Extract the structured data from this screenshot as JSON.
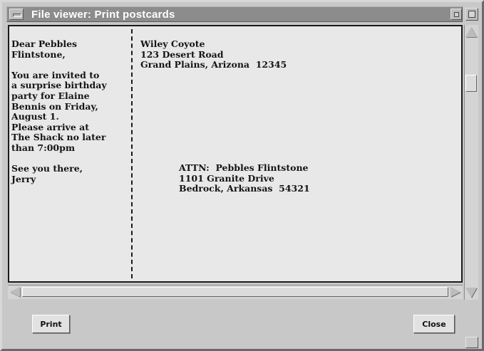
{
  "window": {
    "title": "File viewer: Print postcards"
  },
  "postcard": {
    "message": "Dear Pebbles\nFlintstone,\n\nYou are invited to\na surprise birthday\nparty for Elaine\nBennis on Friday,\nAugust 1.\nPlease arrive at\nThe Shack no later\nthan 7:00pm\n\nSee you there,\nJerry",
    "return_address": "Wiley Coyote\n123 Desert Road\nGrand Plains, Arizona  12345",
    "recipient_address": "ATTN:  Pebbles Flintstone\n1101 Granite Drive\nBedrock, Arkansas  54321"
  },
  "buttons": {
    "print_label": "Print",
    "close_label": "Close"
  },
  "icons": {
    "window_menu": "window-menu-icon",
    "minimize": "minimize-icon",
    "maximize": "maximize-icon",
    "scroll_up": "arrow-up-icon",
    "scroll_down": "arrow-down-icon",
    "scroll_left": "arrow-left-icon",
    "scroll_right": "arrow-right-icon"
  },
  "colors": {
    "titlebar": "#8c8c8c",
    "content_background": "#e8e8e8",
    "window_background": "#c8c8c8"
  }
}
